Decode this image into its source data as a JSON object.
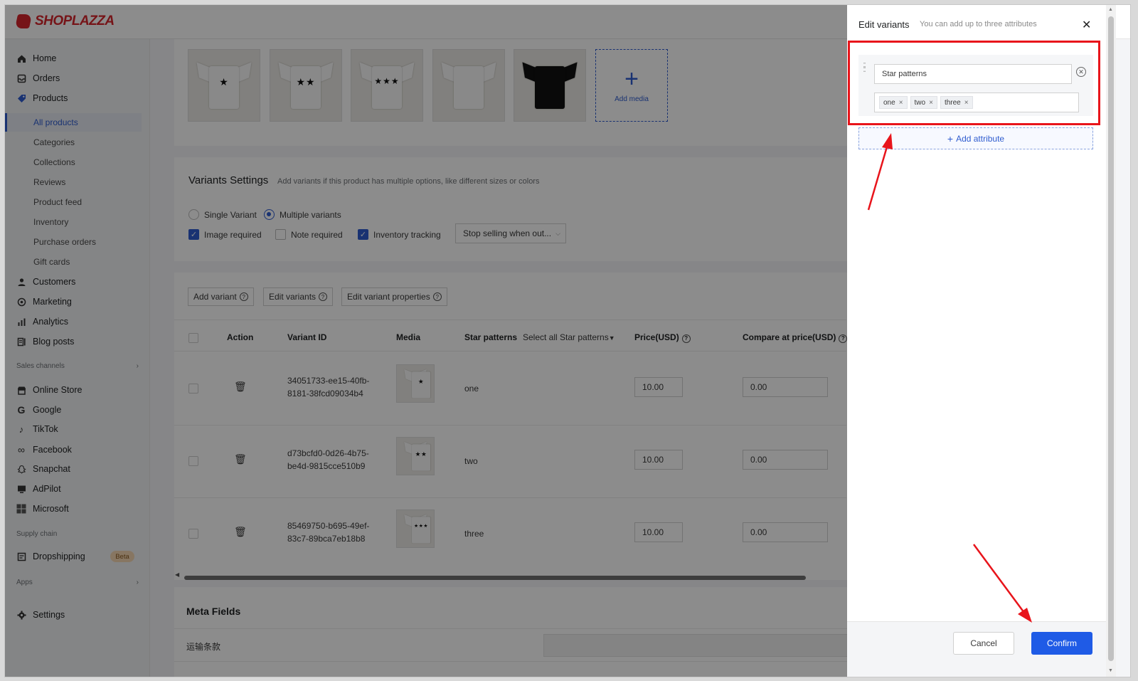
{
  "brand": {
    "name": "SHOPLAZZA"
  },
  "sidebar": {
    "items": [
      {
        "label": "Home",
        "icon": "home-icon"
      },
      {
        "label": "Orders",
        "icon": "orders-icon"
      },
      {
        "label": "Products",
        "icon": "tag-icon"
      }
    ],
    "products_sub": [
      "All products",
      "Categories",
      "Collections",
      "Reviews",
      "Product feed",
      "Inventory",
      "Purchase orders",
      "Gift cards"
    ],
    "items2": [
      {
        "label": "Customers",
        "icon": "user-icon"
      },
      {
        "label": "Marketing",
        "icon": "marketing-icon"
      },
      {
        "label": "Analytics",
        "icon": "analytics-icon"
      },
      {
        "label": "Blog posts",
        "icon": "blog-icon"
      }
    ],
    "sales_channels_label": "Sales channels",
    "channels": [
      "Online Store",
      "Google",
      "TikTok",
      "Facebook",
      "Snapchat",
      "AdPilot",
      "Microsoft"
    ],
    "supply_chain_label": "Supply chain",
    "dropshipping_label": "Dropshipping",
    "beta_badge": "Beta",
    "apps_label": "Apps",
    "settings_label": "Settings"
  },
  "media": {
    "thumbs": [
      "★",
      "★★",
      "★★★",
      "",
      ""
    ],
    "add_media_label": "Add media"
  },
  "variants_settings": {
    "title": "Variants Settings",
    "hint": "Add variants if this product has multiple options, like different sizes or colors",
    "single_variant": "Single Variant",
    "multiple_variants": "Multiple variants",
    "image_required": "Image required",
    "note_required": "Note required",
    "inventory_tracking": "Inventory tracking",
    "stop_selling": "Stop selling when out..."
  },
  "variant_table": {
    "buttons": [
      "Add variant",
      "Edit variants",
      "Edit variant properties"
    ],
    "headers": {
      "action": "Action",
      "variant_id": "Variant ID",
      "media": "Media",
      "star_patterns": "Star patterns",
      "select_all": "Select all Star patterns",
      "price": "Price(USD)",
      "compare_price": "Compare at price(USD)"
    },
    "rows": [
      {
        "id_line1": "34051733-ee15-40fb-",
        "id_line2": "8181-38fcd09034b4",
        "stars": "★",
        "pattern": "one",
        "price": "10.00",
        "compare": "0.00"
      },
      {
        "id_line1": "d73bcfd0-0d26-4b75-",
        "id_line2": "be4d-9815cce510b9",
        "stars": "★★",
        "pattern": "two",
        "price": "10.00",
        "compare": "0.00"
      },
      {
        "id_line1": "85469750-b695-49ef-",
        "id_line2": "83c7-89bca7eb18b8",
        "stars": "★★★",
        "pattern": "three",
        "price": "10.00",
        "compare": "0.00"
      }
    ]
  },
  "meta_fields": {
    "title": "Meta Fields",
    "row_label": "运输条款"
  },
  "drawer": {
    "title": "Edit variants",
    "hint": "You can add up to three attributes",
    "attribute_name": "Star patterns",
    "attribute_values": [
      "one",
      "two",
      "three"
    ],
    "add_attribute": "Add attribute",
    "cancel": "Cancel",
    "confirm": "Confirm"
  },
  "colors": {
    "brand_red": "#d8262c",
    "accent_blue": "#1f5be6",
    "annotation_red": "#e8141b"
  }
}
